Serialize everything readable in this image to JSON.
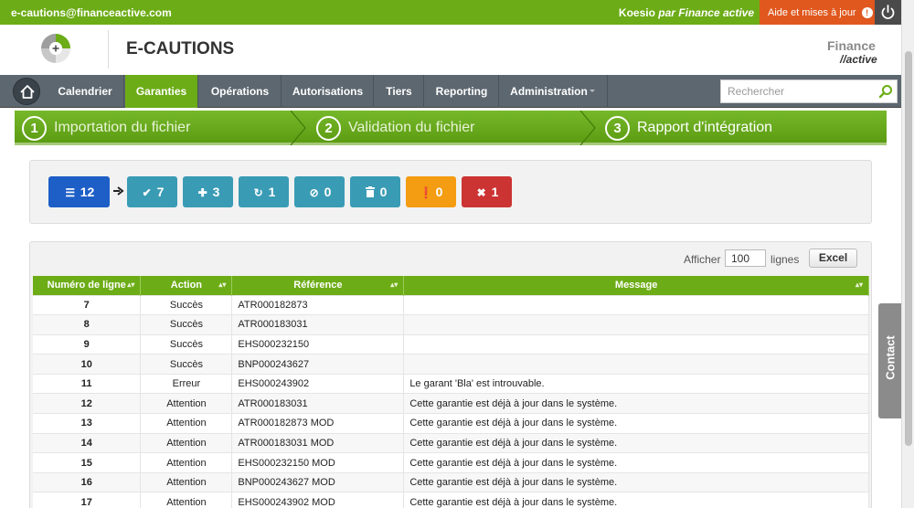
{
  "topbar": {
    "email": "e-cautions@financeactive.com",
    "user": "Koesio",
    "by_label": "par Finance active",
    "help_label": "Aide et mises à jour",
    "help_badge": "!"
  },
  "header": {
    "app_title": "E-CAUTIONS",
    "logo_line1": "Finance",
    "logo_line2": "//active"
  },
  "nav": {
    "items": [
      {
        "label": "Calendrier"
      },
      {
        "label": "Garanties"
      },
      {
        "label": "Opérations"
      },
      {
        "label": "Autorisations"
      },
      {
        "label": "Tiers"
      },
      {
        "label": "Reporting"
      },
      {
        "label": "Administration"
      }
    ],
    "active_index": 1,
    "search_placeholder": "Rechercher"
  },
  "steps": [
    {
      "num": "1",
      "label": "Importation du fichier"
    },
    {
      "num": "2",
      "label": "Validation du fichier"
    },
    {
      "num": "3",
      "label": "Rapport d'intégration"
    }
  ],
  "summary": {
    "buttons": [
      {
        "icon": "list-icon",
        "count": "12",
        "color": "#1d5ec7"
      },
      {
        "icon": "check-icon",
        "count": "7",
        "color": "#3a9bb5"
      },
      {
        "icon": "plus-icon",
        "count": "3",
        "color": "#3a9bb5"
      },
      {
        "icon": "refresh-icon",
        "count": "1",
        "color": "#3a9bb5"
      },
      {
        "icon": "ban-icon",
        "count": "0",
        "color": "#3a9bb5"
      },
      {
        "icon": "trash-icon",
        "count": "0",
        "color": "#3a9bb5"
      },
      {
        "icon": "warning-icon",
        "count": "0",
        "color": "#f49c12"
      },
      {
        "icon": "close-icon",
        "count": "1",
        "color": "#cc3333"
      }
    ]
  },
  "results": {
    "show_label": "Afficher",
    "page_size": "100",
    "rows_label": "lignes",
    "excel_label": "Excel",
    "columns": [
      "Numéro de ligne",
      "Action",
      "Référence",
      "Message"
    ],
    "rows": [
      {
        "num": "7",
        "action": "Succès",
        "ref": "ATR000182873",
        "msg": ""
      },
      {
        "num": "8",
        "action": "Succès",
        "ref": "ATR000183031",
        "msg": ""
      },
      {
        "num": "9",
        "action": "Succès",
        "ref": "EHS000232150",
        "msg": ""
      },
      {
        "num": "10",
        "action": "Succès",
        "ref": "BNP000243627",
        "msg": ""
      },
      {
        "num": "11",
        "action": "Erreur",
        "ref": "EHS000243902",
        "msg": "Le garant 'Bla' est introuvable."
      },
      {
        "num": "12",
        "action": "Attention",
        "ref": "ATR000183031",
        "msg": "Cette garantie est déjà à jour dans le système."
      },
      {
        "num": "13",
        "action": "Attention",
        "ref": "ATR000182873 MOD",
        "msg": "Cette garantie est déjà à jour dans le système."
      },
      {
        "num": "14",
        "action": "Attention",
        "ref": "ATR000183031 MOD",
        "msg": "Cette garantie est déjà à jour dans le système."
      },
      {
        "num": "15",
        "action": "Attention",
        "ref": "EHS000232150 MOD",
        "msg": "Cette garantie est déjà à jour dans le système."
      },
      {
        "num": "16",
        "action": "Attention",
        "ref": "BNP000243627 MOD",
        "msg": "Cette garantie est déjà à jour dans le système."
      },
      {
        "num": "17",
        "action": "Attention",
        "ref": "EHS000243902 MOD",
        "msg": "Cette garantie est déjà à jour dans le système."
      }
    ]
  },
  "contact_label": "Contact"
}
